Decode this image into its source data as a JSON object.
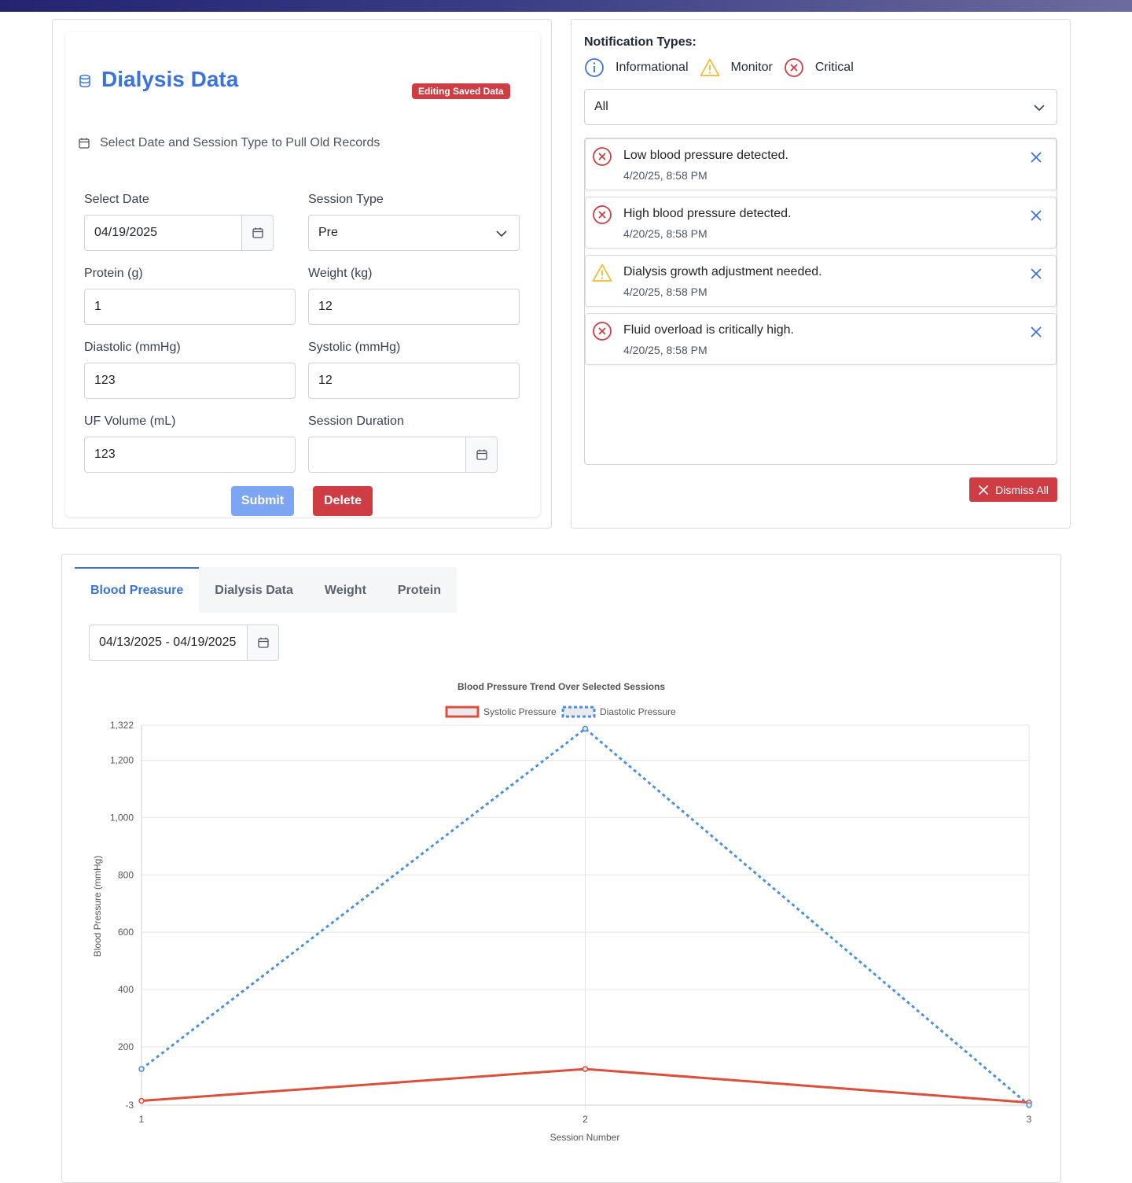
{
  "form": {
    "title": "Dialysis Data",
    "badge": "Editing Saved Data",
    "subtitle": "Select Date and Session Type to Pull Old Records",
    "select_date_label": "Select Date",
    "select_date_value": "04/19/2025",
    "session_type_label": "Session Type",
    "session_type_value": "Pre",
    "protein_label": "Protein (g)",
    "protein_value": "1",
    "weight_label": "Weight (kg)",
    "weight_value": "12",
    "diastolic_label": "Diastolic (mmHg)",
    "diastolic_value": "123",
    "systolic_label": "Systolic (mmHg)",
    "systolic_value": "12",
    "uf_label": "UF Volume (mL)",
    "uf_value": "123",
    "duration_label": "Session Duration",
    "duration_value": "",
    "submit_label": "Submit",
    "delete_label": "Delete"
  },
  "notifications": {
    "types_title": "Notification Types:",
    "types": [
      {
        "label": "Informational",
        "icon": "info-circle-icon",
        "color": "#3b73dd"
      },
      {
        "label": "Monitor",
        "icon": "warning-triangle-icon",
        "color": "#f2b92e"
      },
      {
        "label": "Critical",
        "icon": "x-circle-icon",
        "color": "#cf3d44"
      }
    ],
    "filter_value": "All",
    "items": [
      {
        "message": "Low blood pressure detected.",
        "time": "4/20/25, 8:58 PM",
        "level": "critical"
      },
      {
        "message": "High blood pressure detected.",
        "time": "4/20/25, 8:58 PM",
        "level": "critical"
      },
      {
        "message": "Dialysis growth adjustment needed.",
        "time": "4/20/25, 8:58 PM",
        "level": "monitor"
      },
      {
        "message": "Fluid overload is critically high.",
        "time": "4/20/25, 8:58 PM",
        "level": "critical"
      }
    ],
    "dismiss_all_label": "Dismiss All"
  },
  "chart_panel": {
    "tabs": [
      "Blood Preasure",
      "Dialysis Data",
      "Weight",
      "Protein"
    ],
    "active_tab": 0,
    "date_range": "04/13/2025 - 04/19/2025"
  },
  "chart_data": {
    "type": "line",
    "title": "Blood Pressure Trend Over Selected Sessions",
    "xlabel": "Session Number",
    "ylabel": "Blood Pressure (mmHg)",
    "x": [
      1,
      2,
      3
    ],
    "ylim": [
      -3,
      1322
    ],
    "yticks": [
      -3,
      200,
      400,
      600,
      800,
      1000,
      1200,
      1322
    ],
    "ytick_labels": [
      "-3",
      "200",
      "400",
      "600",
      "800",
      "1,000",
      "1,200",
      "1,322"
    ],
    "legend_position": "top",
    "series": [
      {
        "name": "Systolic Pressure",
        "values": [
          12,
          123,
          6
        ],
        "color": "#dc4f3c",
        "style": "solid"
      },
      {
        "name": "Diastolic Pressure",
        "values": [
          123,
          1310,
          -3
        ],
        "color": "#4a90e2",
        "style": "dashed"
      }
    ]
  }
}
